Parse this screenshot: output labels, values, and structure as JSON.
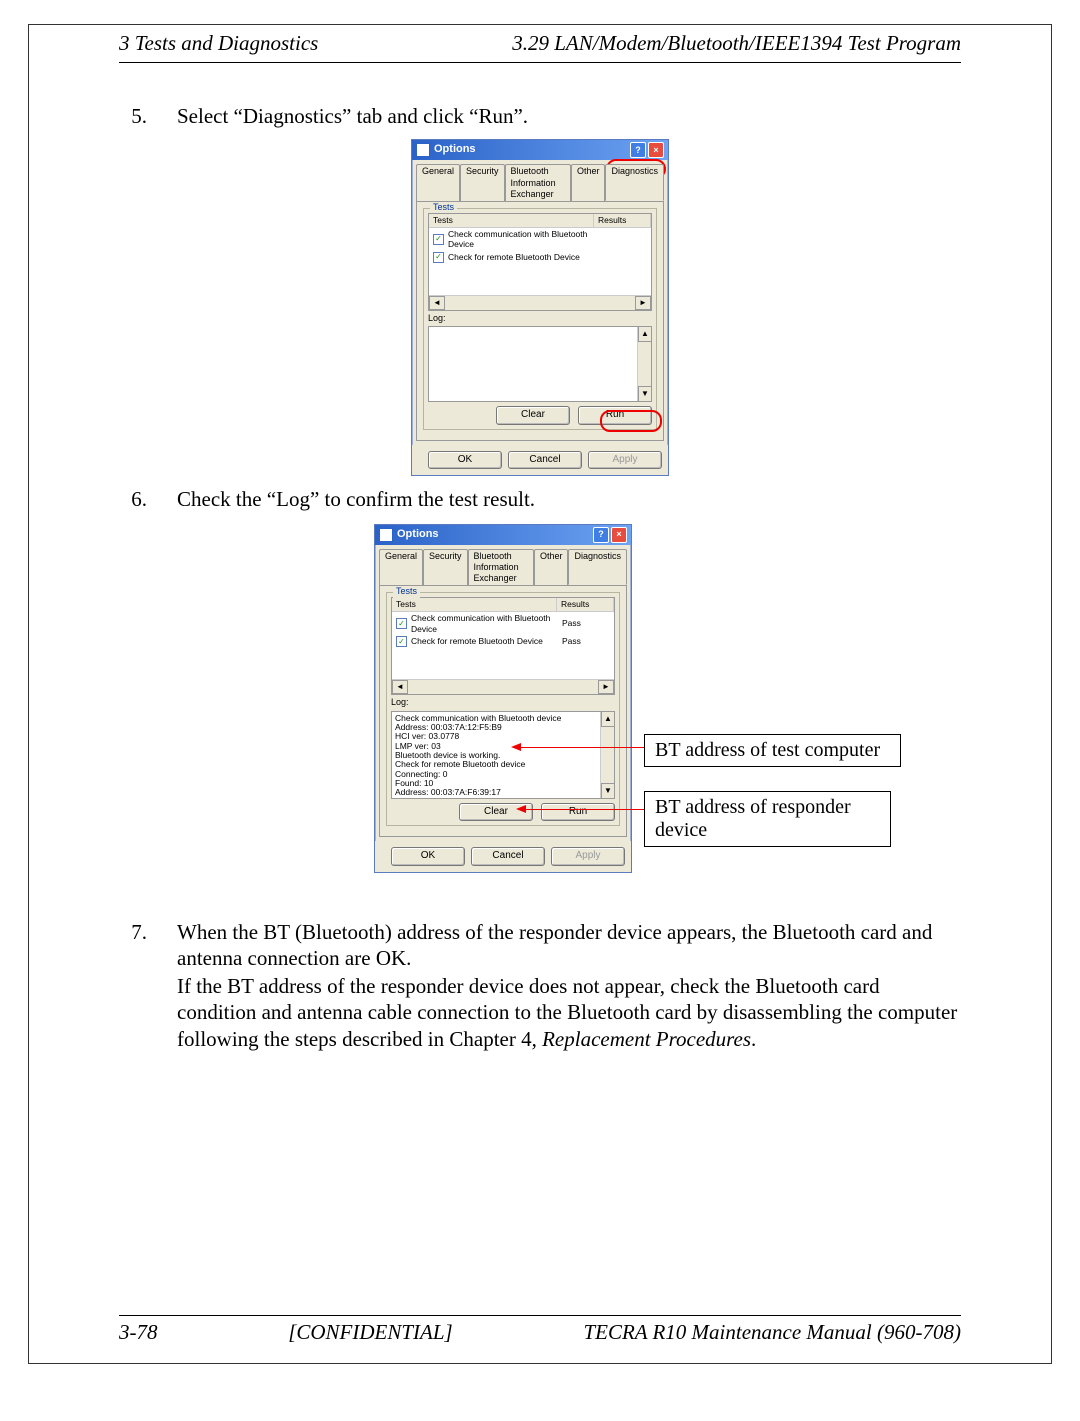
{
  "header": {
    "left": "3 Tests and Diagnostics",
    "right": "3.29 LAN/Modem/Bluetooth/IEEE1394 Test Program"
  },
  "steps": {
    "s5": {
      "num": "5.",
      "text": "Select “Diagnostics” tab and click “Run”."
    },
    "s6": {
      "num": "6.",
      "text": "Check the “Log” to confirm the test result."
    },
    "s7": {
      "num": "7.",
      "p1": "When the BT (Bluetooth) address of the responder device appears, the Bluetooth card and antenna connection are OK.",
      "p2a": "If the BT address of the responder device does not appear, check the Bluetooth card condition and antenna cable connection to the Bluetooth card by disassembling the computer following the steps described in Chapter 4, ",
      "p2b": "Replacement Procedures",
      "p2c": "."
    }
  },
  "dialog": {
    "title": "Options",
    "tabs": {
      "general": "General",
      "security": "Security",
      "btex": "Bluetooth Information Exchanger",
      "other": "Other",
      "diag": "Diagnostics"
    },
    "group_legend": "Tests",
    "test_header": {
      "tests": "Tests",
      "results": "Results"
    },
    "test_rows": {
      "r1": "Check communication with Bluetooth Device",
      "r2": "Check for remote Bluetooth Device"
    },
    "results_pass": "Pass",
    "log_label": "Log:",
    "clear_btn": "Clear",
    "run_btn": "Run",
    "ok_btn": "OK",
    "cancel_btn": "Cancel",
    "apply_btn": "Apply"
  },
  "log2": {
    "l0": "Check communication with Bluetooth device",
    "l1": "Address: 00:03:7A:12:F5:B9",
    "l2": "HCI ver: 03.0778",
    "l3": "LMP ver: 03",
    "l4": "Bluetooth device is working.",
    "l5": "Check for remote Bluetooth device",
    "l6": "Connecting: 0",
    "l7": "Found: 10",
    "l8": "Address: 00:03:7A:F6:39:17"
  },
  "callouts": {
    "c1": "BT address of test computer",
    "c2": "BT address of responder device"
  },
  "footer": {
    "left": "3-78",
    "mid": "[CONFIDENTIAL]",
    "right": "TECRA R10 Maintenance Manual (960-708)"
  }
}
